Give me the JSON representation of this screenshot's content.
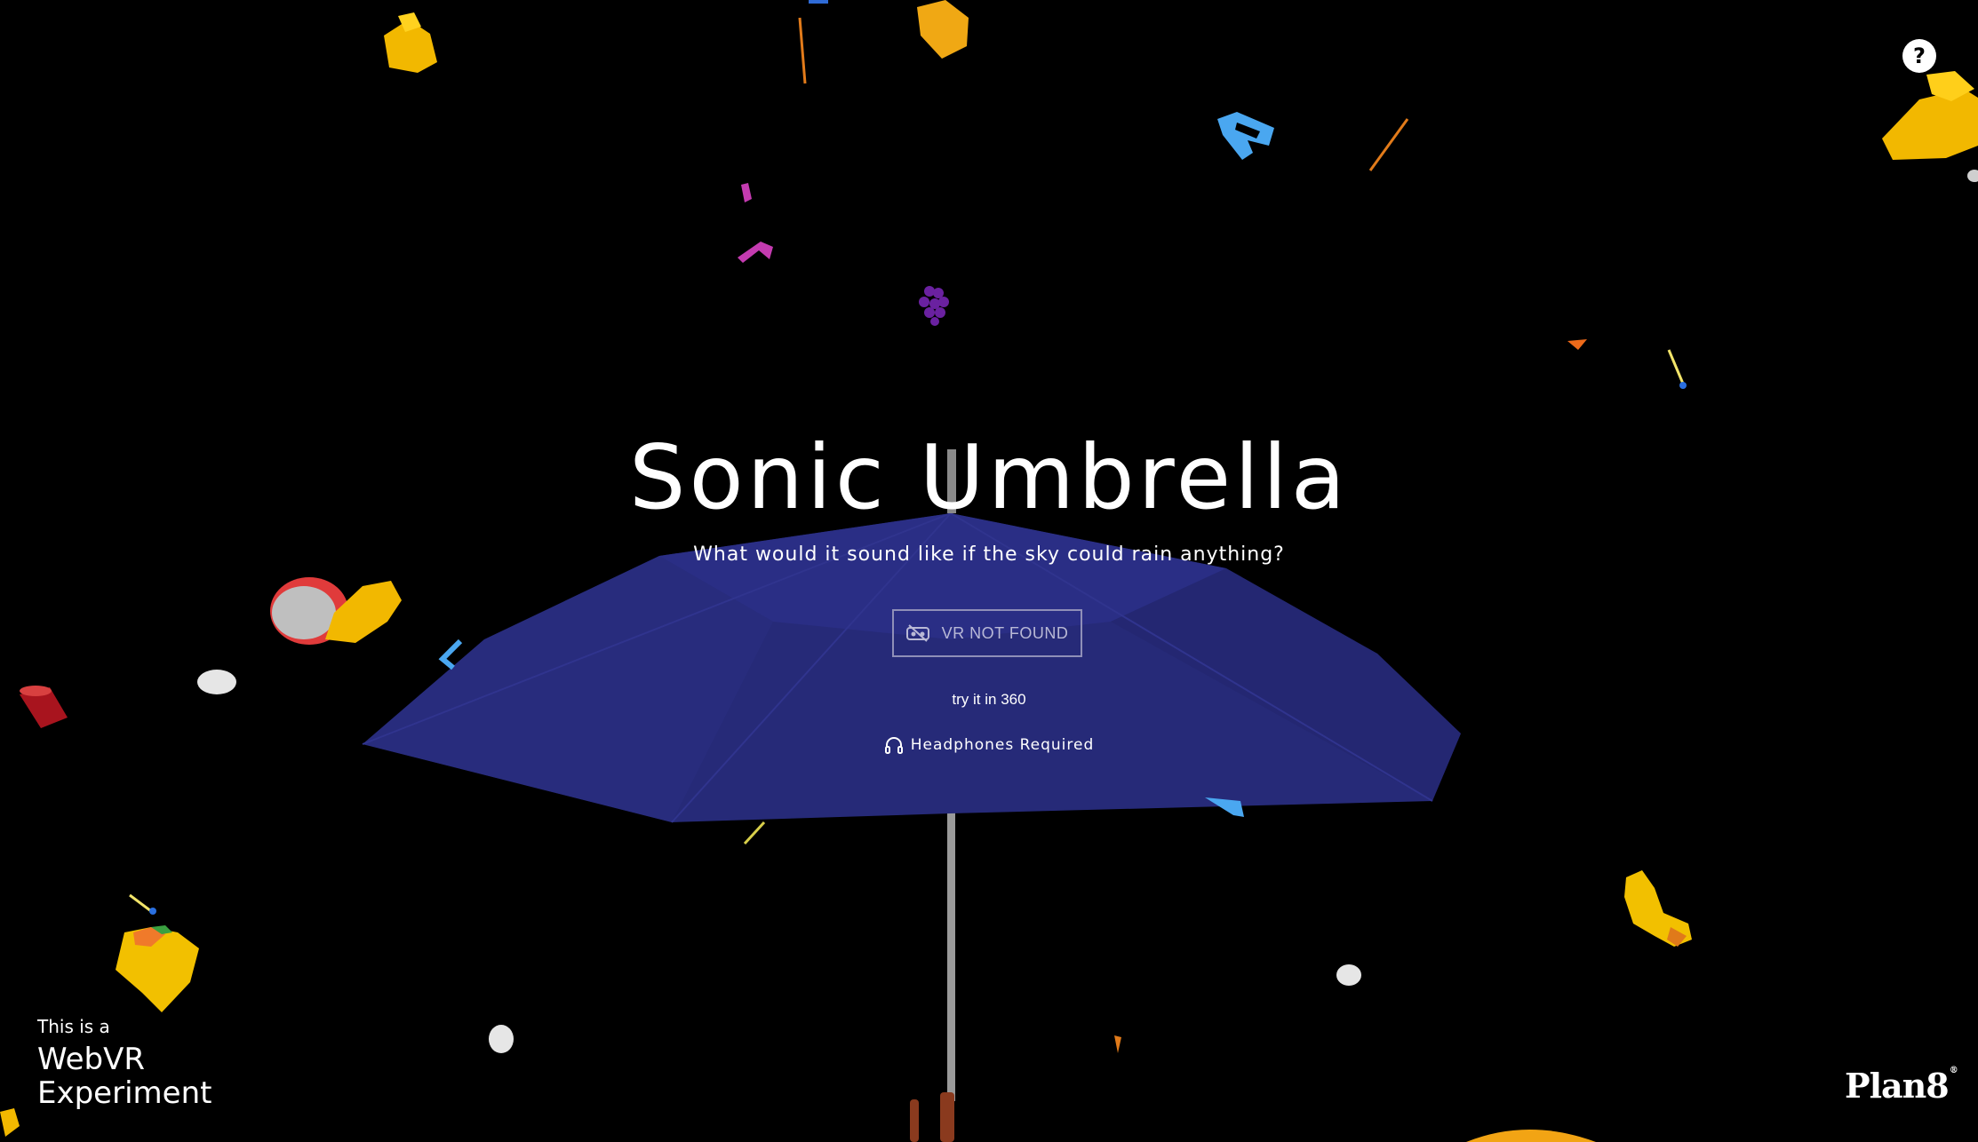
{
  "hero": {
    "title": "Sonic Umbrella",
    "subtitle": "What would it sound like if the sky could rain anything?"
  },
  "vr_button": {
    "label": "VR NOT FOUND",
    "icon": "vr-off-icon"
  },
  "try_360": {
    "label": "try it in 360"
  },
  "headphones": {
    "label": "Headphones Required",
    "icon": "headphones-icon"
  },
  "help": {
    "label": "?"
  },
  "webvr": {
    "line1": "This is a",
    "line2": "WebVR",
    "line3": "Experiment"
  },
  "brand": {
    "logo_text": "Plan8",
    "mark": "®"
  },
  "colors": {
    "background": "#000000",
    "umbrella": "#26297a",
    "button_border": "#8f8fb8"
  }
}
